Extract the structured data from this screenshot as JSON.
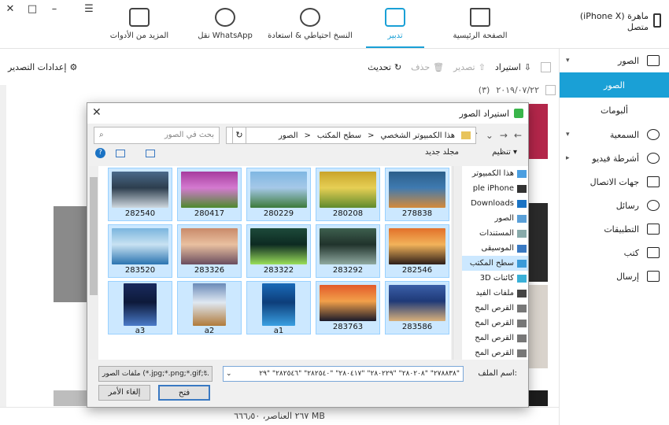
{
  "window": {
    "min_label": "–",
    "max_label": "□",
    "close_label": "✕",
    "menu_label": "☰"
  },
  "device": {
    "name": "ماهرة (iPhone X)",
    "status": "متصل"
  },
  "nav": {
    "home": "الصفحة الرئيسية",
    "manage": "تدبير",
    "backup": "النسخ احتياطي & استعادة",
    "whatsapp": "نقل WhatsApp",
    "tools": "المزيد من الأدوات"
  },
  "sidebar": {
    "photos": "الصور",
    "photos_sub": "الصور",
    "albums": "ألبومات",
    "audio": "السمعية",
    "video": "أشرطة فيديو",
    "contacts": "جهات الاتصال",
    "messages": "رسائل",
    "apps": "التطبيقات",
    "books": "كتب",
    "send": "إرسال"
  },
  "toolbar": {
    "import": "استيراد",
    "export": "تصدير",
    "delete": "حذف",
    "refresh": "تحديث",
    "export_settings": "إعدادات التصدير"
  },
  "date_group": {
    "date": "٢٠١٩/٠٧/٢٢",
    "count": "(٣)"
  },
  "status": {
    "text": "٢٦٧ العناصر، ٦٦٦٫٥٠ MB"
  },
  "dialog": {
    "title": "استيراد الصور",
    "breadcrumb": [
      "هذا الكمبيوتر الشخصي",
      "سطح المكتب",
      "الصور"
    ],
    "search_placeholder": "بحث في الصور",
    "organize": "تنظيم",
    "new_folder": "مجلد جديد",
    "tree": [
      "هذا الكمبيوتر",
      "ple iPhone",
      "Downloads",
      "الصور",
      "المستندات",
      "الموسيقى",
      "سطح المكتب",
      "كائنات 3D",
      "ملفات الفيد",
      "القرص المح",
      "القرص المح",
      "القرص المح",
      "القرص المح"
    ],
    "files": [
      {
        "name": "278838",
        "colors": [
          "#2c5f8a",
          "#d48a3a",
          "#3f7ab0"
        ]
      },
      {
        "name": "280208",
        "colors": [
          "#c9a42a",
          "#5f8a2d",
          "#e6cf54"
        ]
      },
      {
        "name": "280229",
        "colors": [
          "#7fb7e2",
          "#3c7a3a",
          "#a5c8e8"
        ]
      },
      {
        "name": "280417",
        "colors": [
          "#a63c9e",
          "#4d8a2d",
          "#d47ad0"
        ]
      },
      {
        "name": "282540",
        "colors": [
          "#4a6a8a",
          "#cfd8df",
          "#2d3e4e"
        ]
      },
      {
        "name": "282546",
        "colors": [
          "#e2702a",
          "#2d1e18",
          "#f2b35a"
        ]
      },
      {
        "name": "283292",
        "colors": [
          "#3d5f4e",
          "#8fa9a0",
          "#21332c"
        ]
      },
      {
        "name": "283322",
        "colors": [
          "#1d4a3a",
          "#9adf5a",
          "#0d2a22"
        ]
      },
      {
        "name": "283326",
        "colors": [
          "#c98a6a",
          "#6a4d5e",
          "#e9c0a0"
        ]
      },
      {
        "name": "283520",
        "colors": [
          "#7ab5de",
          "#2a74b0",
          "#c8e2f2"
        ]
      },
      {
        "name": "283586",
        "colors": [
          "#3b5fa8",
          "#d9b07a",
          "#1f3a78"
        ]
      },
      {
        "name": "283763",
        "colors": [
          "#e25a2a",
          "#1a1a2a",
          "#f2a04a"
        ]
      },
      {
        "name": "a1",
        "colors": [
          "#1a6ab8",
          "#3aa0e2",
          "#0d3e7a"
        ]
      },
      {
        "name": "a2",
        "colors": [
          "#6a8ab8",
          "#b07a3a",
          "#dfe8f2"
        ]
      },
      {
        "name": "a3",
        "colors": [
          "#1a2a5e",
          "#4a7ac8",
          "#0d1a3a"
        ]
      }
    ],
    "filename_label": "اسم الملف:",
    "filename_value": "\"٢٧٨٨٣٨\" \"٢٨٠٢٠٨\" \"٢٨٠٢٢٩\" \"٢٨٠٤١٧\" \"٢٨٢٥٤٠\" \"٢٨٢٥٤٦\" \"٢٩",
    "filter_value": "ملفات الصور (*.jpg;*.png;*.gif;*.",
    "open": "فتح",
    "cancel": "إلغاء الأمر"
  },
  "colors": {
    "accent": "#1aa0d6",
    "selection": "#cce8ff"
  }
}
